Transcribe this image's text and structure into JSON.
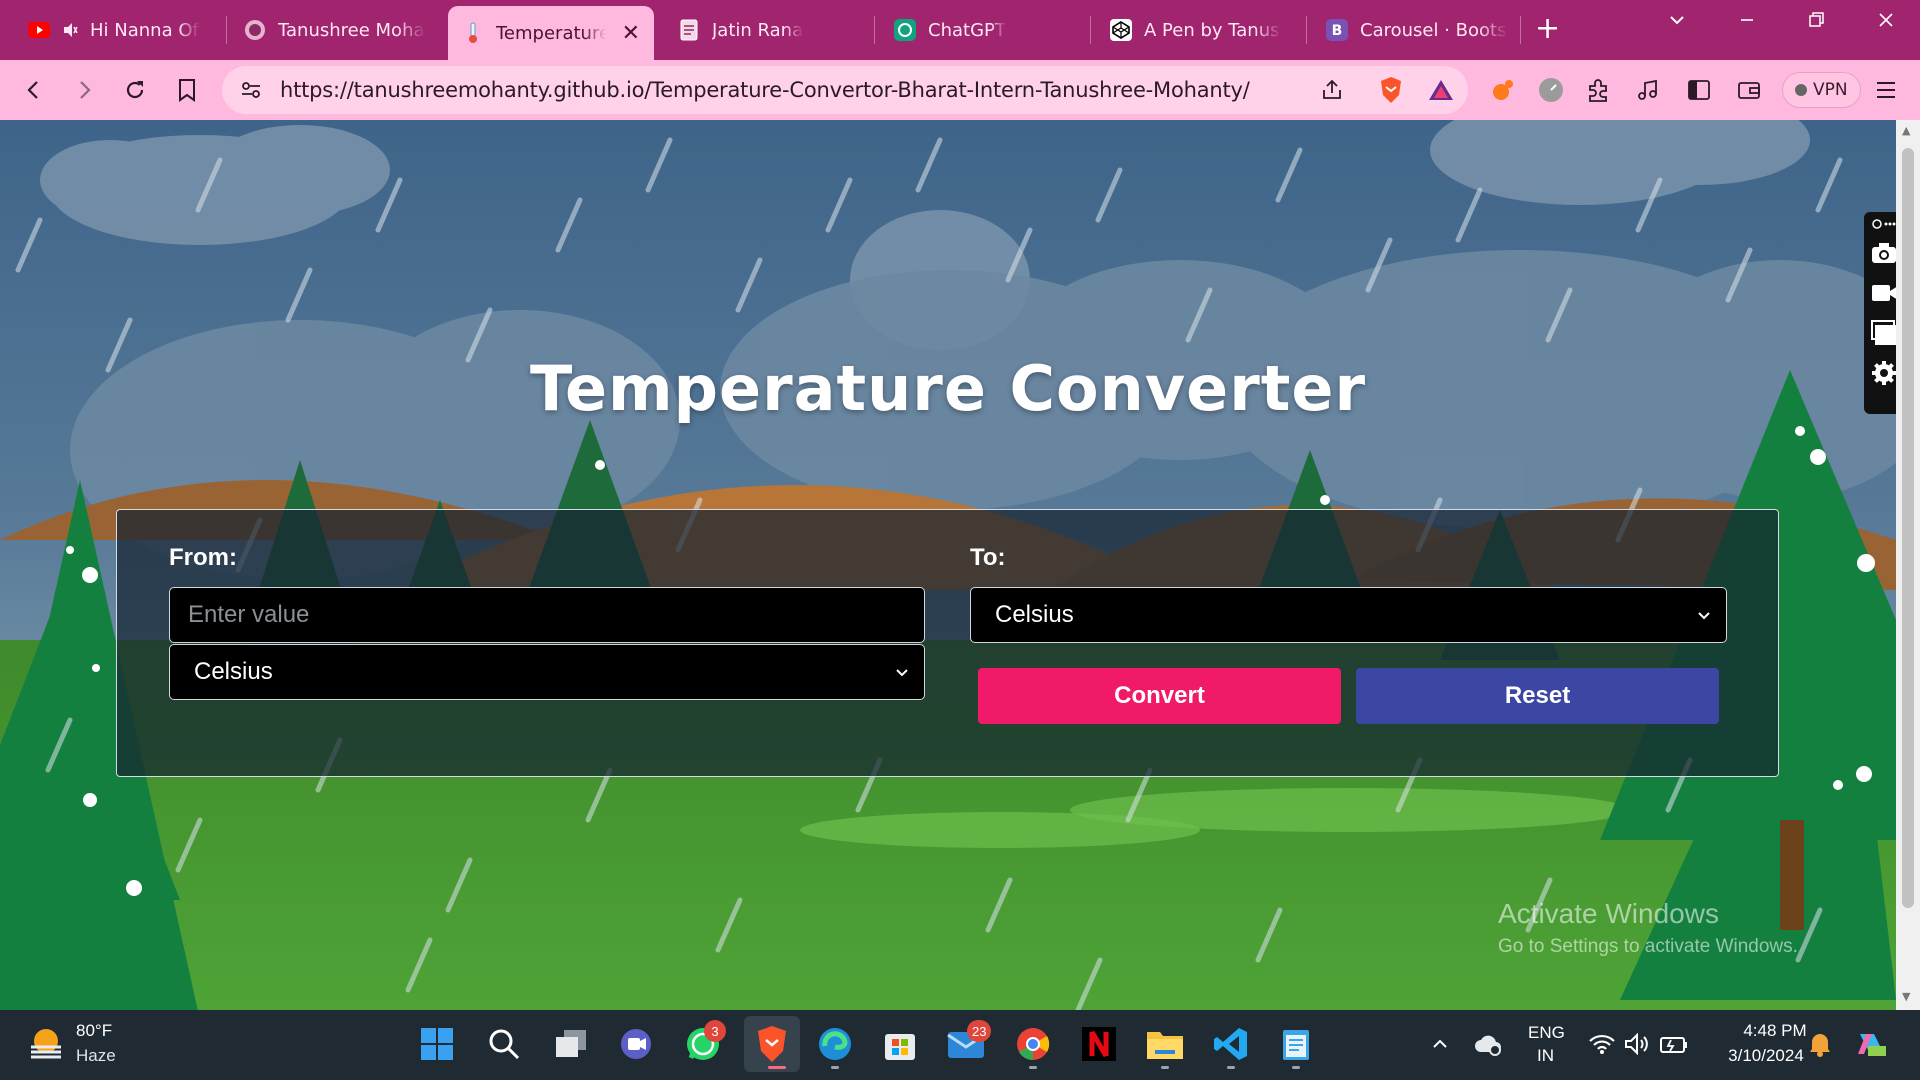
{
  "browser": {
    "tabs": [
      {
        "label": "Hi Nanna Offic",
        "icon": "youtube-icon",
        "muted": true
      },
      {
        "label": "Tanushree Mohant",
        "icon": "globe-icon"
      },
      {
        "label": "Temperature C",
        "icon": "thermometer-icon",
        "active": true
      },
      {
        "label": "Jatin Rana",
        "icon": "document-icon"
      },
      {
        "label": "ChatGPT",
        "icon": "chatgpt-icon"
      },
      {
        "label": "A Pen by Tanushre",
        "icon": "codepen-icon"
      },
      {
        "label": "Carousel · Bootstra",
        "icon": "bootstrap-icon"
      }
    ],
    "url": "https://tanushreemohanty.github.io/Temperature-Convertor-Bharat-Intern-Tanushree-Mohanty/",
    "vpn_label": "VPN",
    "bootstrap_letter": "B"
  },
  "page": {
    "title": "Temperature Converter",
    "from_label": "From:",
    "to_label": "To:",
    "value_placeholder": "Enter value",
    "from_unit": "Celsius",
    "to_unit": "Celsius",
    "convert_label": "Convert",
    "reset_label": "Reset",
    "convert_color": "#f01a68",
    "reset_color": "#3c46a3"
  },
  "watermark": {
    "line1": "Activate Windows",
    "line2": "Go to Settings to activate Windows."
  },
  "taskbar": {
    "weather_temp": "80°F",
    "weather_desc": "Haze",
    "whatsapp_badge": "3",
    "mail_badge": "23",
    "lang_line1": "ENG",
    "lang_line2": "IN",
    "time": "4:48 PM",
    "date": "3/10/2024"
  }
}
